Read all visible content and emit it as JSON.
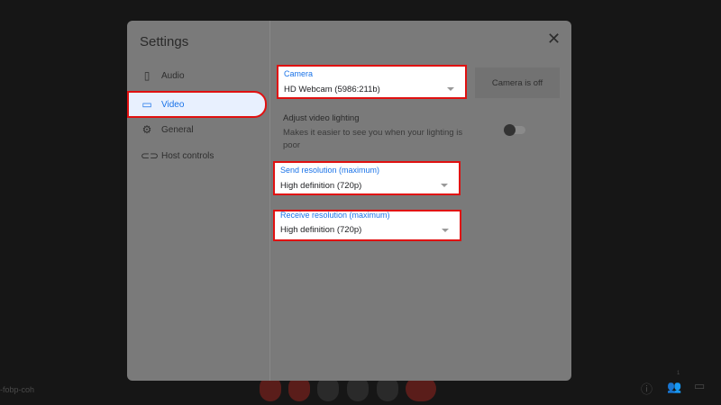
{
  "dialog": {
    "title": "Settings",
    "close_icon": "close-icon"
  },
  "sidebar": {
    "items": [
      {
        "label": "Audio",
        "icon": "speaker-icon"
      },
      {
        "label": "Video",
        "icon": "videocam-icon",
        "active": true
      },
      {
        "label": "General",
        "icon": "gear-icon"
      },
      {
        "label": "Host controls",
        "icon": "toggle-icon"
      }
    ]
  },
  "video": {
    "camera": {
      "label": "Camera",
      "value": "HD Webcam (5986:211b)"
    },
    "preview": "Camera is off",
    "lighting": {
      "title": "Adjust video lighting",
      "description": "Makes it easier to see you when your lighting is poor",
      "enabled": false
    },
    "send": {
      "label": "Send resolution (maximum)",
      "value": "High definition (720p)"
    },
    "receive": {
      "label": "Receive resolution (maximum)",
      "value": "High definition (720p)"
    }
  },
  "meeting": {
    "code": "-fobp-coh",
    "participants": "1"
  },
  "colors": {
    "accent": "#1a73e8",
    "highlight": "#e01010",
    "end_call": "#c5221f"
  }
}
